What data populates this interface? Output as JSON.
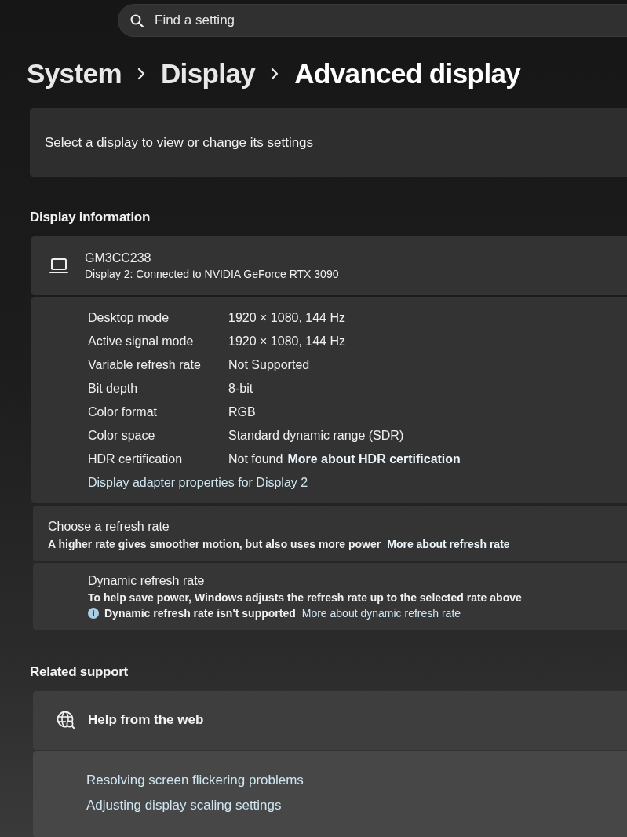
{
  "search": {
    "placeholder": "Find a setting"
  },
  "breadcrumb": [
    "System",
    "Display",
    "Advanced display"
  ],
  "display_selector": {
    "label": "Select a display to view or change its settings"
  },
  "display_information": {
    "heading": "Display information",
    "monitor": {
      "name": "GM3CC238",
      "connection": "Display 2: Connected to NVIDIA GeForce RTX 3090"
    },
    "properties": [
      {
        "label": "Desktop mode",
        "value": "1920 × 1080, 144 Hz"
      },
      {
        "label": "Active signal mode",
        "value": "1920 × 1080, 144 Hz"
      },
      {
        "label": "Variable refresh rate",
        "value": "Not Supported"
      },
      {
        "label": "Bit depth",
        "value": "8-bit"
      },
      {
        "label": "Color format",
        "value": "RGB"
      },
      {
        "label": "Color space",
        "value": "Standard dynamic range (SDR)"
      },
      {
        "label": "HDR certification",
        "value": "Not found",
        "link": "More about HDR certification"
      }
    ],
    "adapter_link": "Display adapter properties for Display 2"
  },
  "refresh_rate": {
    "title": "Choose a refresh rate",
    "description": "A higher rate gives smoother motion, but also uses more power",
    "link": "More about refresh rate"
  },
  "dynamic_refresh_rate": {
    "title": "Dynamic refresh rate",
    "description": "To help save power, Windows adjusts the refresh rate up to the selected rate above",
    "notice": "Dynamic refresh rate isn't supported",
    "link": "More about dynamic refresh rate"
  },
  "related_support": {
    "heading": "Related support",
    "help": {
      "title": "Help from the web",
      "links": [
        "Resolving screen flickering problems",
        "Adjusting display scaling settings"
      ]
    }
  }
}
